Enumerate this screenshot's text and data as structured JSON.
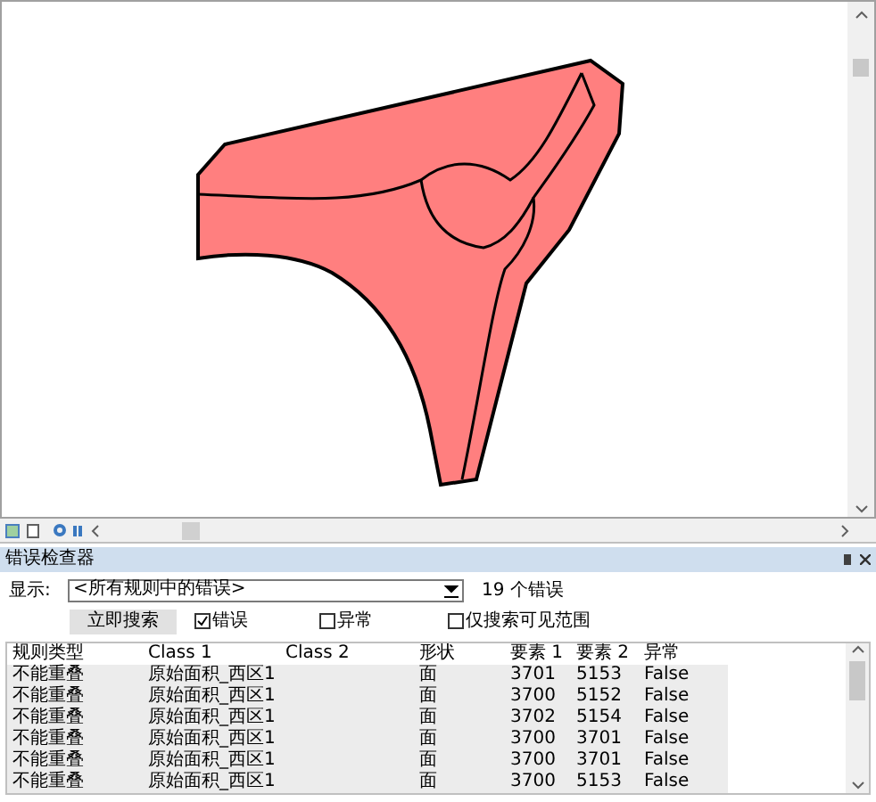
{
  "panel": {
    "title": "错误检查器"
  },
  "filter": {
    "label": "显示:",
    "value": "<所有规则中的错误>",
    "count": "19 个错误"
  },
  "search_button": "立即搜索",
  "options": [
    {
      "label": "错误",
      "checked": true
    },
    {
      "label": "异常",
      "checked": false
    },
    {
      "label": "仅搜索可见范围",
      "checked": false
    }
  ],
  "table": {
    "columns": [
      "规则类型",
      "Class 1",
      "Class 2",
      "形状",
      "要素 1",
      "要素 2",
      "异常"
    ],
    "rows": [
      [
        "不能重叠",
        "原始面积_西区1",
        null,
        "面",
        "3701",
        "5153",
        "False"
      ],
      [
        "不能重叠",
        "原始面积_西区1",
        null,
        "面",
        "3700",
        "5152",
        "False"
      ],
      [
        "不能重叠",
        "原始面积_西区1",
        null,
        "面",
        "3702",
        "5154",
        "False"
      ],
      [
        "不能重叠",
        "原始面积_西区1",
        null,
        "面",
        "3700",
        "3701",
        "False"
      ],
      [
        "不能重叠",
        "原始面积_西区1",
        null,
        "面",
        "3700",
        "3701",
        "False"
      ],
      [
        "不能重叠",
        "原始面积_西区1",
        null,
        "面",
        "3700",
        "5153",
        "False"
      ]
    ]
  }
}
